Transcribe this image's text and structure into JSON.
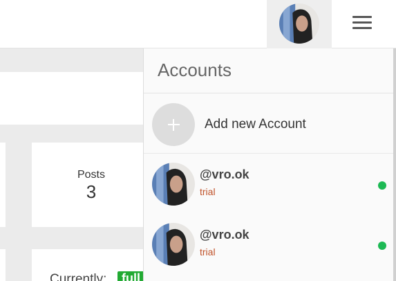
{
  "header": {
    "avatar_icon": "user-avatar-photo",
    "menu_icon": "hamburger-menu-icon"
  },
  "background": {
    "posts_label": "Posts",
    "posts_value": "3",
    "current_label": "Currently:",
    "current_badge": "full"
  },
  "accounts_panel": {
    "title": "Accounts",
    "add_label": "Add new Account",
    "add_icon": "plus-icon",
    "accounts": [
      {
        "handle": "@vro.ok",
        "plan": "trial",
        "status_color": "#1db954"
      },
      {
        "handle": "@vro.ok",
        "plan": "trial",
        "status_color": "#1db954"
      }
    ]
  },
  "colors": {
    "plan_text": "#c0532a",
    "online_dot": "#1db954",
    "badge_green": "#22aa33"
  }
}
